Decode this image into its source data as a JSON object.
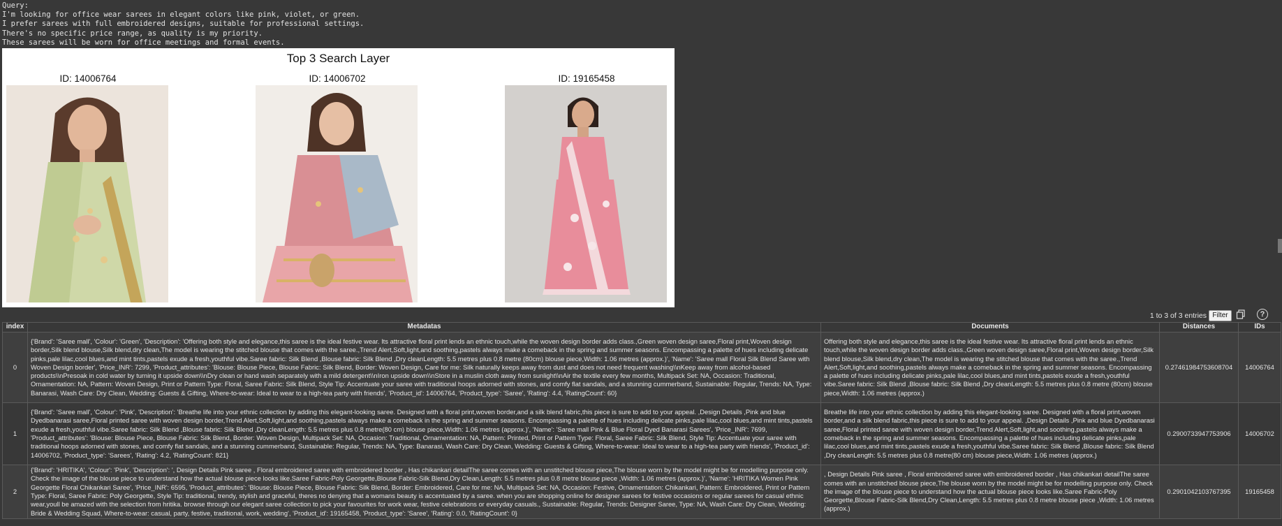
{
  "query": {
    "label": "Query:",
    "lines": [
      "I'm looking for office wear sarees in elegant colors like pink, violet, or green.",
      "I prefer sarees with full embroidered designs, suitable for professional settings.",
      "There's no specific price range, as quality is my priority.",
      "These sarees will be worn for office meetings and formal events."
    ]
  },
  "figure": {
    "title": "Top 3 Search Layer",
    "panels": [
      {
        "id_label": "ID: 14006764",
        "saree_color": "#cfd8a8"
      },
      {
        "id_label": "ID: 14006702",
        "saree_color": "#e8a5a8"
      },
      {
        "id_label": "ID: 19165458",
        "saree_color": "#e88d9b"
      }
    ]
  },
  "table_controls": {
    "entries": "1 to 3 of 3 entries",
    "filter_label": "Filter",
    "help_label": "?"
  },
  "table": {
    "columns": [
      "index",
      "Metadatas",
      "Documents",
      "Distances",
      "IDs"
    ],
    "rows": [
      {
        "index": "0",
        "metadata": "{'Brand': 'Saree mall', 'Colour': 'Green', 'Description': 'Offering both style and elegance,this saree is the ideal festive wear. Its attractive floral print lends an ethnic touch,while the woven design border adds class.,Green woven design saree,Floral print,Woven design border,Silk blend blouse,Silk blend,dry clean,The model is wearing the stitched blouse that comes with the saree.,Trend Alert,Soft,light,and soothing,pastels always make a comeback in the spring and summer seasons. Encompassing a palette of hues including delicate pinks,pale lilac,cool blues,and mint tints,pastels exude a fresh,youthful vibe.Saree fabric: Silk Blend ,Blouse fabric: Silk Blend ,Dry cleanLength: 5.5 metres plus 0.8 metre (80cm) blouse piece,Width: 1.06 metres (approx.)', 'Name': 'Saree mall Floral Silk Blend Saree with Woven Design border', 'Price_INR': 7299, 'Product_attributes': 'Blouse: Blouse Piece, Blouse Fabric: Silk Blend, Border: Woven Design, Care for me: Silk naturally keeps away from dust and does not need frequent washing\\\\nKeep away from alcohol-based products\\\\nPresoak in cold water by turning it upside down\\\\nDry clean or hand wash separately with a mild detergent\\\\nIron upside down\\\\nStore in a muslin cloth away from sunlight\\\\nAir the textile every few months, Multipack Set: NA, Occasion: Traditional, Ornamentation: NA, Pattern: Woven Design, Print or Pattern Type: Floral, Saree Fabric: Silk Blend, Style Tip: Accentuate your saree with traditional hoops adorned with stones, and comfy flat sandals, and a stunning cummerband, Sustainable: Regular, Trends: NA, Type: Banarasi, Wash Care: Dry Clean, Wedding: Guests & Gifting, Where-to-wear: Ideal to wear to a high-tea party with friends', 'Product_id': 14006764, 'Product_type': 'Saree', 'Rating': 4.4, 'RatingCount': 60}",
        "document": "Offering both style and elegance,this saree is the ideal festive wear. Its attractive floral print lends an ethnic touch,while the woven design border adds class.,Green woven design saree,Floral print,Woven design border,Silk blend blouse,Silk blend,dry clean,The model is wearing the stitched blouse that comes with the saree.,Trend Alert,Soft,light,and soothing,pastels always make a comeback in the spring and summer seasons. Encompassing a palette of hues including delicate pinks,pale lilac,cool blues,and mint tints,pastels exude a fresh,youthful vibe.Saree fabric: Silk Blend ,Blouse fabric: Silk Blend ,Dry cleanLength: 5.5 metres plus 0.8 metre (80cm) blouse piece,Width: 1.06 metres (approx.)",
        "distance": "0.27461984753608704",
        "id": "14006764"
      },
      {
        "index": "1",
        "metadata": "{'Brand': 'Saree mall', 'Colour': 'Pink', 'Description': 'Breathe life into your ethnic collection by adding this elegant-looking saree. Designed with a floral print,woven border,and a silk blend fabric,this piece is sure to add to your appeal. ,Design Details ,Pink and blue Dyedbanarasi saree,Floral printed saree with woven design border,Trend Alert,Soft,light,and soothing,pastels always make a comeback in the spring and summer seasons. Encompassing a palette of hues including delicate pinks,pale lilac,cool blues,and mint tints,pastels exude a fresh,youthful vibe.Saree fabric: Silk Blend ,Blouse fabric: Silk Blend ,Dry cleanLength: 5.5 metres plus 0.8 metre(80 cm) blouse piece,Width: 1.06 metres (approx.)', 'Name': 'Saree mall Pink & Blue Floral Dyed Banarasi Sarees', 'Price_INR': 7699, 'Product_attributes': 'Blouse: Blouse Piece, Blouse Fabric: Silk Blend, Border: Woven Design, Multipack Set: NA, Occasion: Traditional, Ornamentation: NA, Pattern: Printed, Print or Pattern Type: Floral, Saree Fabric: Silk Blend, Style Tip: Accentuate your saree with traditional hoops adorned with stones, and comfy flat sandals, and a stunning cummerband, Sustainable: Regular, Trends: NA, Type: Banarasi, Wash Care: Dry Clean, Wedding: Guests & Gifting, Where-to-wear: Ideal to wear to a high-tea party with friends', 'Product_id': 14006702, 'Product_type': 'Sarees', 'Rating': 4.2, 'RatingCount': 821}",
        "document": "Breathe life into your ethnic collection by adding this elegant-looking saree. Designed with a floral print,woven border,and a silk blend fabric,this piece is sure to add to your appeal. ,Design Details ,Pink and blue Dyedbanarasi saree,Floral printed saree with woven design border,Trend Alert,Soft,light,and soothing,pastels always make a comeback in the spring and summer seasons. Encompassing a palette of hues including delicate pinks,pale lilac,cool blues,and mint tints,pastels exude a fresh,youthful vibe.Saree fabric: Silk Blend ,Blouse fabric: Silk Blend ,Dry cleanLength: 5.5 metres plus 0.8 metre(80 cm) blouse piece,Width: 1.06 metres (approx.)",
        "distance": "0.2900733947753906",
        "id": "14006702"
      },
      {
        "index": "2",
        "metadata": "{'Brand': 'HRITIKA', 'Colour': 'Pink', 'Description': ', Design Details Pink saree , Floral embroidered saree with embroidered border , Has chikankari detailThe saree comes with an unstitched blouse piece,The blouse worn by the model might be for modelling purpose only. Check the image of the blouse piece to understand how the actual blouse piece looks like.Saree Fabric-Poly Georgette,Blouse Fabric-Silk Blend,Dry Clean,Length: 5.5 metres plus 0.8 metre blouse piece ,Width: 1.06 metres (approx.)', 'Name': 'HRITIKA Women Pink Georgette Floral Chikankari Saree', 'Price_INR': 6595, 'Product_attributes': 'Blouse: Blouse Piece, Blouse Fabric: Silk Blend, Border: Embroidered, Care for me: NA, Multipack Set: NA, Occasion: Festive, Ornamentation: Chikankari, Pattern: Embroidered, Print or Pattern Type: Floral, Saree Fabric: Poly Georgette, Style Tip: traditional, trendy, stylish and graceful, theres no denying that a womans beauty is accentuated by a saree. when you are shopping online for designer sarees for festive occasions or regular sarees for casual ethnic wear,youll be amazed with the selection from hritika. browse through our elegant saree collection to pick your favourites for work wear, festive celebrations or everyday casuals., Sustainable: Regular, Trends: Designer Saree, Type: NA, Wash Care: Dry Clean, Wedding: Bride & Wedding Squad, Where-to-wear: casual, party, festive, traditional, work, wedding', 'Product_id': 19165458, 'Product_type': 'Saree', 'Rating': 0.0, 'RatingCount': 0}",
        "document": ", Design Details Pink saree , Floral embroidered saree with embroidered border , Has chikankari detailThe saree comes with an unstitched blouse piece,The blouse worn by the model might be for modelling purpose only. Check the image of the blouse piece to understand how the actual blouse piece looks like.Saree Fabric-Poly Georgette,Blouse Fabric-Silk Blend,Dry Clean,Length: 5.5 metres plus 0.8 metre blouse piece ,Width: 1.06 metres (approx.)",
        "distance": "0.2901042103767395",
        "id": "19165458"
      }
    ]
  }
}
